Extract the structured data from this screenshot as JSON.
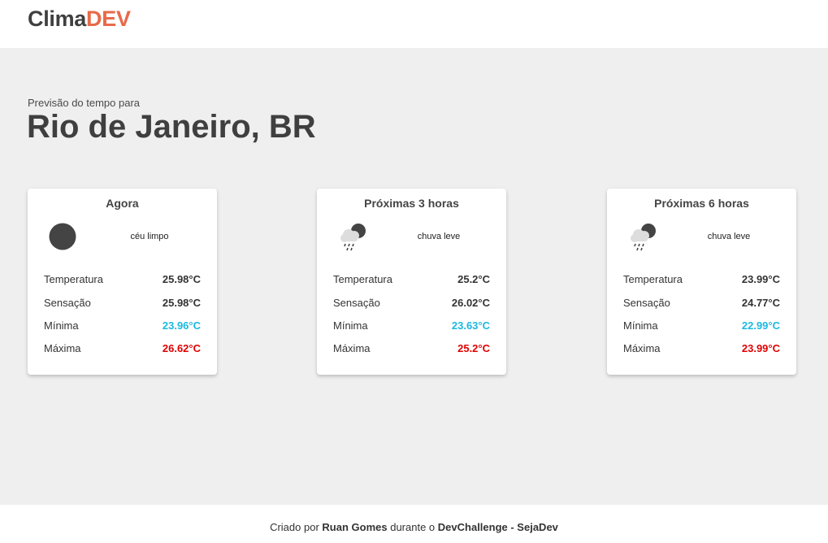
{
  "header": {
    "logo_part1": "Clima",
    "logo_part2": "DEV",
    "logo_color_primary": "#3f3f3f",
    "logo_color_accent": "#e8694a"
  },
  "location": {
    "subtitle": "Previsão do tempo para",
    "city": "Rio de Janeiro, BR"
  },
  "forecasts": [
    {
      "title": "Agora",
      "icon": "clear-sky-icon",
      "description": "céu limpo",
      "rows": [
        {
          "label": "Temperatura",
          "value": "25.98°C"
        },
        {
          "label": "Sensação",
          "value": "25.98°C"
        },
        {
          "label": "Mínima",
          "value": "23.96°C"
        },
        {
          "label": "Máxima",
          "value": "26.62°C"
        }
      ]
    },
    {
      "title": "Próximas 3 horas",
      "icon": "light-rain-icon",
      "description": "chuva leve",
      "rows": [
        {
          "label": "Temperatura",
          "value": "25.2°C"
        },
        {
          "label": "Sensação",
          "value": "26.02°C"
        },
        {
          "label": "Mínima",
          "value": "23.63°C"
        },
        {
          "label": "Máxima",
          "value": "25.2°C"
        }
      ]
    },
    {
      "title": "Próximas 6 horas",
      "icon": "light-rain-icon",
      "description": "chuva leve",
      "rows": [
        {
          "label": "Temperatura",
          "value": "23.99°C"
        },
        {
          "label": "Sensação",
          "value": "24.77°C"
        },
        {
          "label": "Mínima",
          "value": "22.99°C"
        },
        {
          "label": "Máxima",
          "value": "23.99°C"
        }
      ]
    }
  ],
  "colors": {
    "min_temp": "#1cb8e0",
    "max_temp": "#e00000",
    "background": "#efefef"
  },
  "footer": {
    "prefix": "Criado por",
    "author": "Ruan Gomes",
    "middle": "durante o",
    "event": "DevChallenge - SejaDev"
  }
}
